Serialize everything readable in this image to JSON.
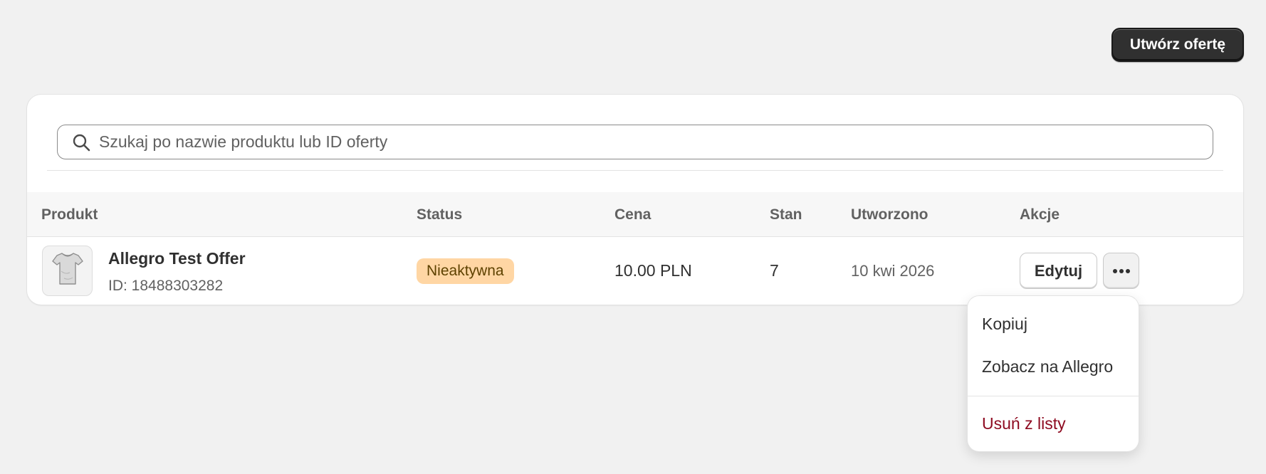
{
  "header": {
    "create_button": "Utwórz ofertę"
  },
  "search": {
    "placeholder": "Szukaj po nazwie produktu lub ID oferty",
    "value": ""
  },
  "table": {
    "columns": [
      "Produkt",
      "Status",
      "Cena",
      "Stan",
      "Utworzono",
      "Akcje"
    ],
    "rows": [
      {
        "thumbnail_icon": "tshirt-icon",
        "name": "Allegro Test Offer",
        "id_text": "ID: 18488303282",
        "status": "Nieaktywna",
        "price": "10.00 PLN",
        "stock": "7",
        "created": "10 kwi 2026",
        "edit_label": "Edytuj"
      }
    ]
  },
  "actions_menu": {
    "items": [
      "Kopiuj",
      "Zobacz na Allegro"
    ],
    "danger_item": "Usuń z listy"
  },
  "colors": {
    "primary_button": "#303030",
    "status_inactive_bg": "#ffd6a4",
    "danger_text": "#8e0b21"
  }
}
